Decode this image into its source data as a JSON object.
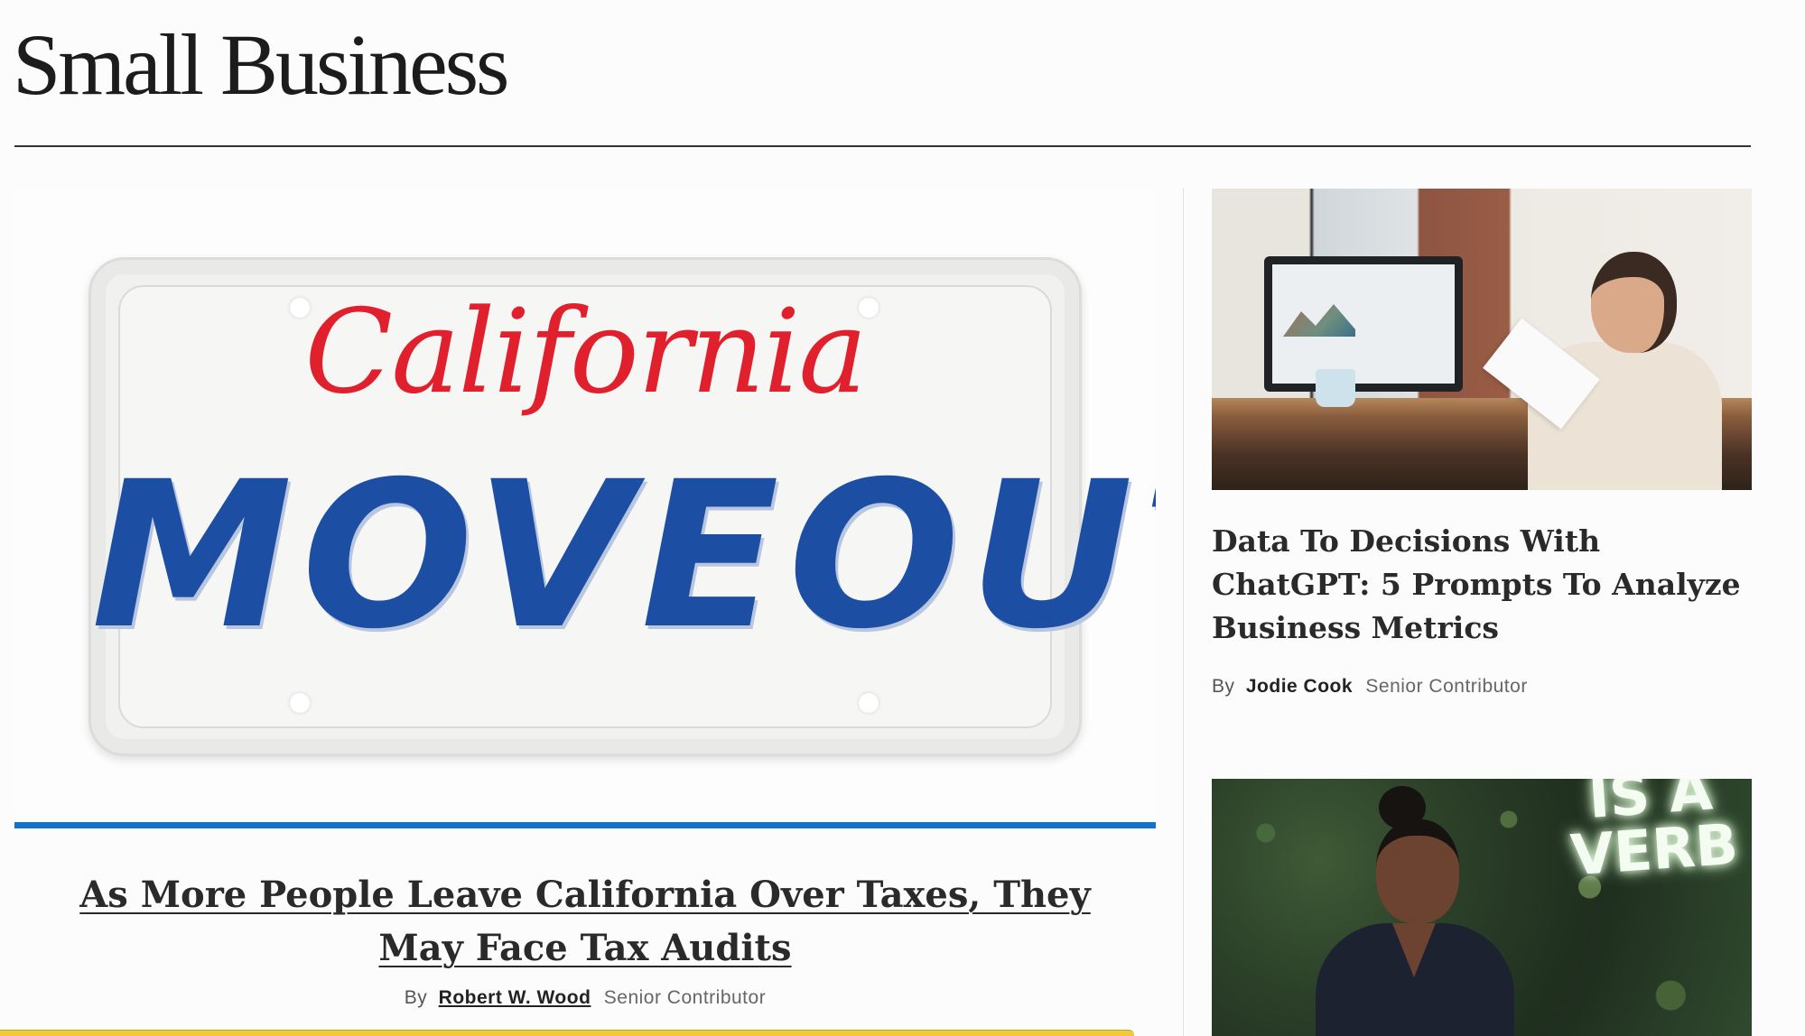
{
  "section": {
    "title": "Small Business"
  },
  "featured": {
    "image": {
      "plate_state": "California",
      "plate_number": "MOVEOUT"
    },
    "headline": "As More People Leave California Over Taxes, They May Face Tax Audits",
    "byline": {
      "by": "By",
      "author": "Robert W. Wood",
      "role": "Senior Contributor"
    }
  },
  "sidebar": {
    "articles": [
      {
        "headline": "Data To Decisions With ChatGPT: 5 Prompts To Analyze Business Metrics",
        "byline": {
          "by": "By",
          "author": "Jodie Cook",
          "role": "Senior Contributor"
        }
      }
    ],
    "second_image": {
      "sign_text": "IS A VERB"
    }
  },
  "colors": {
    "accent_rule": "#1471c9",
    "plate_red": "#e0202d",
    "plate_blue": "#1c4ea3",
    "bottom_bar": "#f0ca3a"
  }
}
